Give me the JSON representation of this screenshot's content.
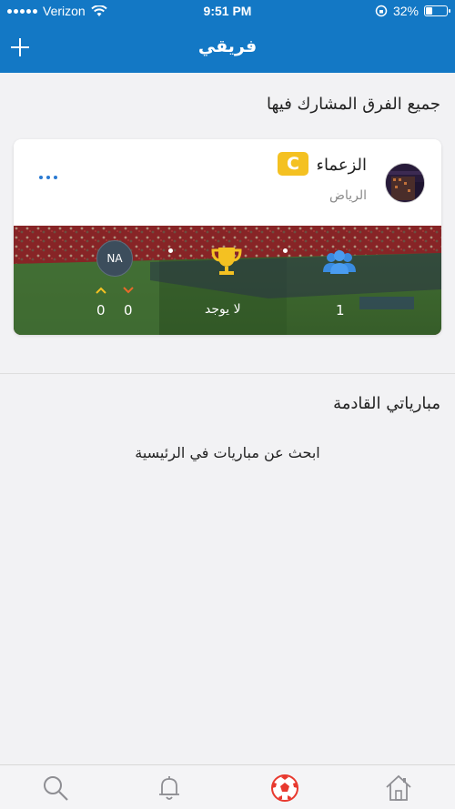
{
  "status_bar": {
    "carrier": "Verizon",
    "time": "9:51 PM",
    "battery": "32%",
    "battery_level": 0.32
  },
  "nav": {
    "title": "فريقي",
    "add_icon": "plus-icon"
  },
  "teams_section": {
    "title": "جميع الفرق المشارك فيها"
  },
  "team_card": {
    "name": "الزعماء",
    "badge": "C",
    "city": "الرياض",
    "more_icon": "ellipsis-icon",
    "stats": {
      "players_count": "1",
      "players_icon": "users-icon",
      "trophies_text": "لا يوجد",
      "trophy_icon": "trophy-icon",
      "rating": "NA",
      "wins": "0",
      "losses": "0"
    }
  },
  "matches_section": {
    "title": "مبارياتي القادمة",
    "empty_text": "ابحث عن مباريات في الرئيسية"
  },
  "tab_bar": {
    "items": [
      {
        "icon": "search-icon"
      },
      {
        "icon": "bell-icon"
      },
      {
        "icon": "football-icon",
        "active": true
      },
      {
        "icon": "home-icon"
      }
    ]
  },
  "colors": {
    "primary": "#1378c5",
    "badge": "#f4c122",
    "trophy": "#f4c122",
    "users_icon": "#3a8be0",
    "active_tab": "#e8392f"
  }
}
